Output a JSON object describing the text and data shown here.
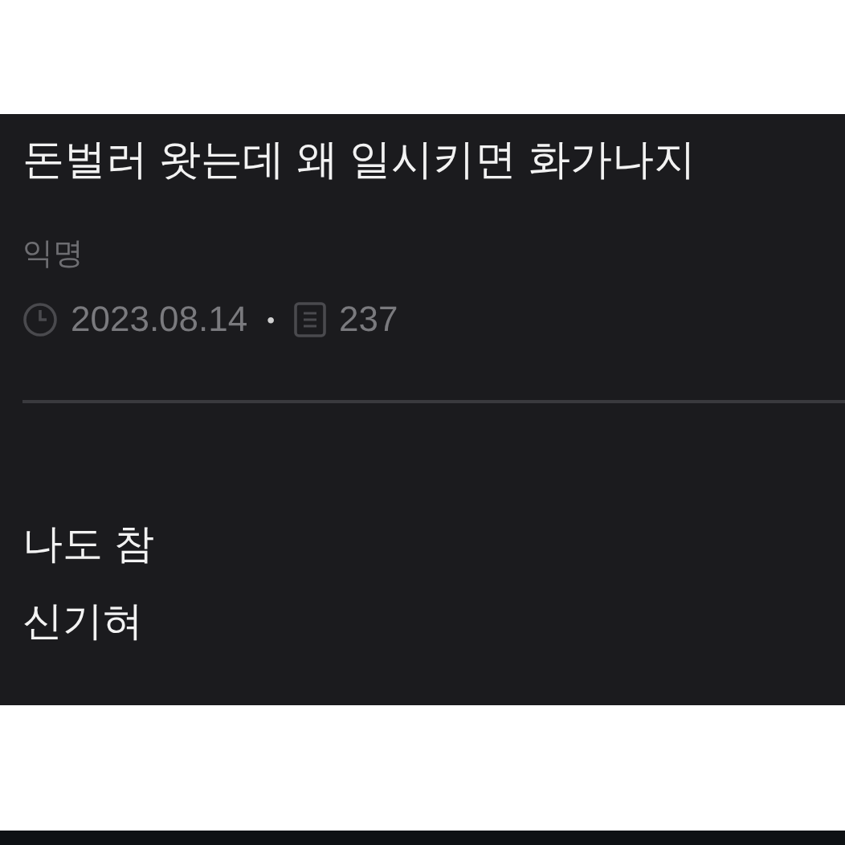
{
  "post": {
    "title": "돈벌러 왓는데 왜 일시키면 화가나지",
    "author": "익명",
    "date": "2023.08.14",
    "separator": "•",
    "views": "237",
    "body": [
      "나도 참",
      "신기혀"
    ]
  }
}
